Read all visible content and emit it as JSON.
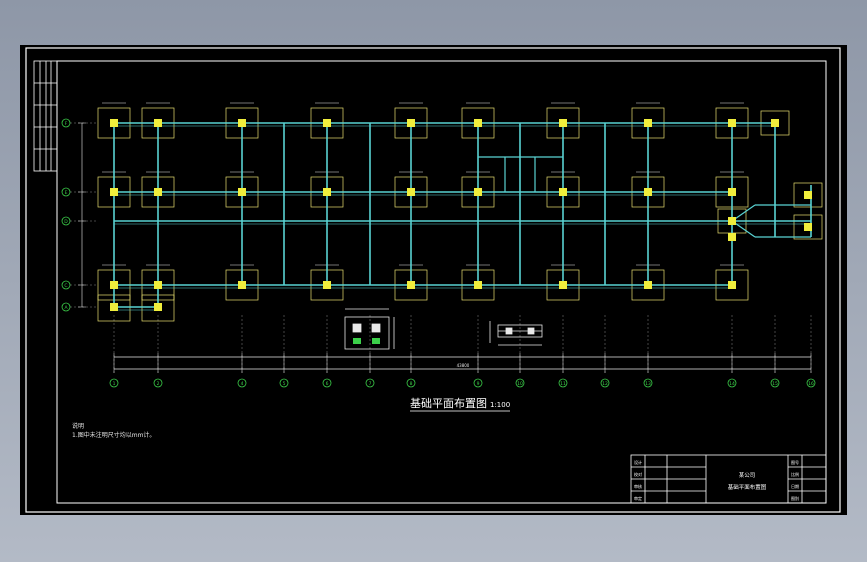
{
  "drawing": {
    "title": "基础平面布置图",
    "title_suffix": "1:100",
    "notes_heading": "说明",
    "notes_line": "1.图中未注明尺寸均以mm计。",
    "total_dim": "43800"
  },
  "grid": {
    "columns": [
      "1",
      "2",
      "4",
      "5",
      "6",
      "7",
      "8",
      "9",
      "10",
      "11",
      "12",
      "13",
      "14",
      "15",
      "16"
    ],
    "rows": [
      "F",
      "E",
      "D",
      "C",
      "A"
    ]
  },
  "title_block": {
    "project": "某公司",
    "drawing_name": "基础平面布置图",
    "cells": [
      "设计",
      "校对",
      "审核",
      "审定",
      "图号",
      "比例",
      "日期",
      "图别"
    ]
  },
  "colors": {
    "beam": "#59d3d3",
    "column": "#f0ee3c",
    "footing": "#e8e070",
    "dim": "#e8e8e8",
    "frame": "#ffffff",
    "background": "#000000"
  }
}
